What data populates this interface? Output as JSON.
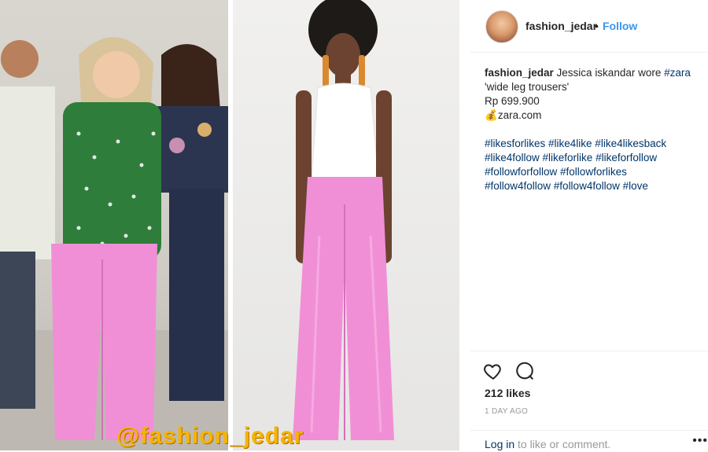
{
  "post": {
    "watermark": "@fashion_jedar",
    "header": {
      "username": "fashion_jedar",
      "separator": "•",
      "follow_label": "Follow"
    },
    "caption": {
      "username": "fashion_jedar",
      "text1": "Jessica iskandar wore",
      "tag1": "#zara",
      "text2": "'wide leg trousers'",
      "price": "Rp 699.900",
      "emoji": "💰",
      "site": "zara.com"
    },
    "hashtags": [
      "#likesforlikes #like4like #like4likesback",
      "#like4follow #likeforlike #likeforfollow",
      "#followforfollow #followforlikes",
      "#follow4follow #follow4follow #love"
    ],
    "likes": "212 likes",
    "date": "1 DAY AGO",
    "comment": {
      "login_link": "Log in",
      "rest": " to like or comment.",
      "more": "•••"
    }
  },
  "colors": {
    "link": "#3897f0",
    "hashtag": "#003569",
    "watermark": "#f5b400",
    "trousers": "#f08fd6"
  },
  "icons": {
    "heart": "heart-icon",
    "comment": "comment-icon",
    "more": "more-options-icon"
  }
}
